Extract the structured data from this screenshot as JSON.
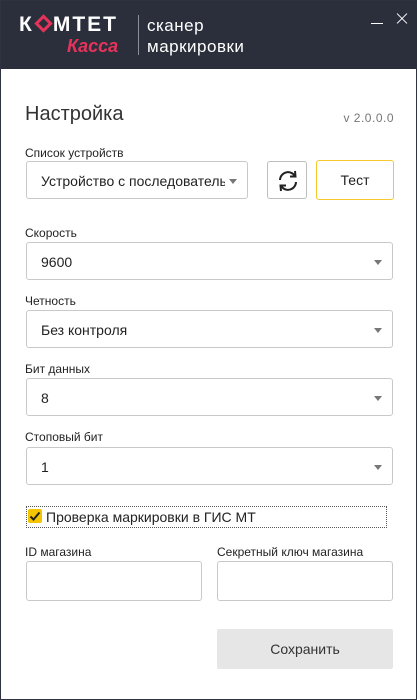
{
  "titlebar": {
    "logo_top_left": "К",
    "logo_top_right": "МТЕТ",
    "logo_bottom": "Касса",
    "tagline_line1": "сканер",
    "tagline_line2": "маркировки"
  },
  "header": {
    "title": "Настройка",
    "version": "v 2.0.0.0"
  },
  "devices": {
    "label": "Список устройств",
    "value": "Устройство с последовательным портом",
    "test_label": "Тест"
  },
  "speed": {
    "label": "Скорость",
    "value": "9600"
  },
  "parity": {
    "label": "Четность",
    "value": "Без контроля"
  },
  "databits": {
    "label": "Бит данных",
    "value": "8"
  },
  "stopbits": {
    "label": "Стоповый бит",
    "value": "1"
  },
  "gis_check": {
    "label": "Проверка маркировки в ГИС МТ",
    "checked": true
  },
  "store_id": {
    "label": "ID магазина",
    "value": ""
  },
  "secret_key": {
    "label": "Секретный ключ магазина",
    "value": ""
  },
  "save_label": "Сохранить",
  "colors": {
    "titlebar": "#2b2f3c",
    "brand": "#e6335a",
    "accent": "#f5c400"
  }
}
